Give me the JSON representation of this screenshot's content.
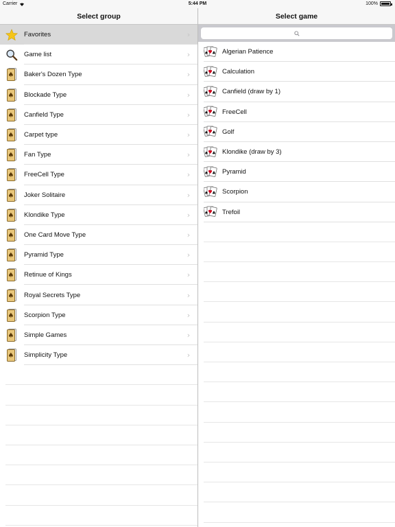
{
  "status": {
    "carrier": "Carrier",
    "time": "5:44 PM",
    "battery": "100%"
  },
  "left": {
    "title": "Select group",
    "items": [
      {
        "label": "Favorites",
        "icon": "star-icon"
      },
      {
        "label": "Game list",
        "icon": "magnifier-icon"
      },
      {
        "label": "Baker's Dozen Type",
        "icon": "card-icon"
      },
      {
        "label": "Blockade Type",
        "icon": "card-icon"
      },
      {
        "label": "Canfield Type",
        "icon": "card-icon"
      },
      {
        "label": "Carpet type",
        "icon": "card-icon"
      },
      {
        "label": "Fan Type",
        "icon": "card-icon"
      },
      {
        "label": "FreeCell Type",
        "icon": "card-icon"
      },
      {
        "label": "Joker Solitaire",
        "icon": "card-icon"
      },
      {
        "label": "Klondike Type",
        "icon": "card-icon"
      },
      {
        "label": "One Card Move Type",
        "icon": "card-icon"
      },
      {
        "label": "Pyramid Type",
        "icon": "card-icon"
      },
      {
        "label": "Retinue of Kings",
        "icon": "card-icon"
      },
      {
        "label": "Royal Secrets Type",
        "icon": "card-icon"
      },
      {
        "label": "Scorpion Type",
        "icon": "card-icon"
      },
      {
        "label": "Simple Games",
        "icon": "card-icon"
      },
      {
        "label": "Simplicity Type",
        "icon": "card-icon"
      }
    ]
  },
  "right": {
    "title": "Select game",
    "search_placeholder": "",
    "items": [
      {
        "label": "Algerian Patience",
        "icon": "cards-fan-icon"
      },
      {
        "label": "Calculation",
        "icon": "cards-fan-icon"
      },
      {
        "label": "Canfield (draw by 1)",
        "icon": "cards-fan-icon"
      },
      {
        "label": "FreeCell",
        "icon": "cards-fan-icon"
      },
      {
        "label": "Golf",
        "icon": "cards-fan-icon"
      },
      {
        "label": "Klondike (draw by 3)",
        "icon": "cards-fan-icon"
      },
      {
        "label": "Pyramid",
        "icon": "cards-fan-icon"
      },
      {
        "label": "Scorpion",
        "icon": "cards-fan-icon"
      },
      {
        "label": "Trefoil",
        "icon": "cards-fan-icon"
      }
    ]
  },
  "colors": {
    "selected_row": "#d9d9d9",
    "star": "#f5c518",
    "card_back": "#e8c67a",
    "suit_red": "#d0021b"
  }
}
